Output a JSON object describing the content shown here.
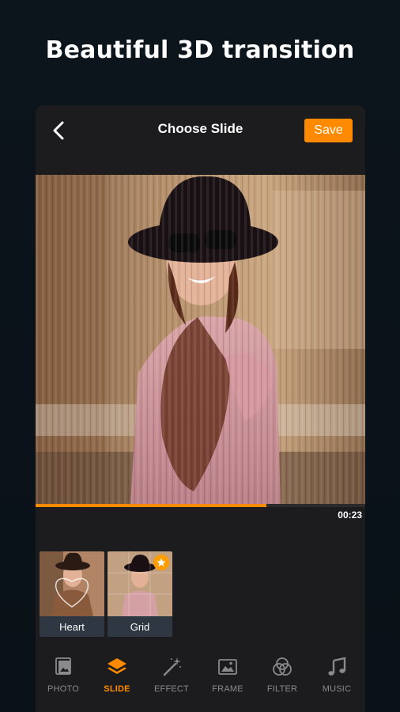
{
  "headline": "Beautiful 3D transition",
  "header": {
    "title": "Choose Slide",
    "save_label": "Save"
  },
  "player": {
    "progress": 0.7,
    "time": "00:23"
  },
  "slides": [
    {
      "label": "Heart",
      "premium": false
    },
    {
      "label": "Grid",
      "premium": true
    }
  ],
  "nav": [
    {
      "label": "PHOTO",
      "icon": "photo-icon",
      "active": false
    },
    {
      "label": "SLIDE",
      "icon": "layers-icon",
      "active": true
    },
    {
      "label": "EFFECT",
      "icon": "magic-wand-icon",
      "active": false
    },
    {
      "label": "FRAME",
      "icon": "frame-icon",
      "active": false
    },
    {
      "label": "FILTER",
      "icon": "filter-icon",
      "active": false
    },
    {
      "label": "MUSIC",
      "icon": "music-icon",
      "active": false
    }
  ],
  "colors": {
    "accent": "#ff8a00",
    "background": "#0c141c",
    "panel": "#1c1c1e"
  }
}
